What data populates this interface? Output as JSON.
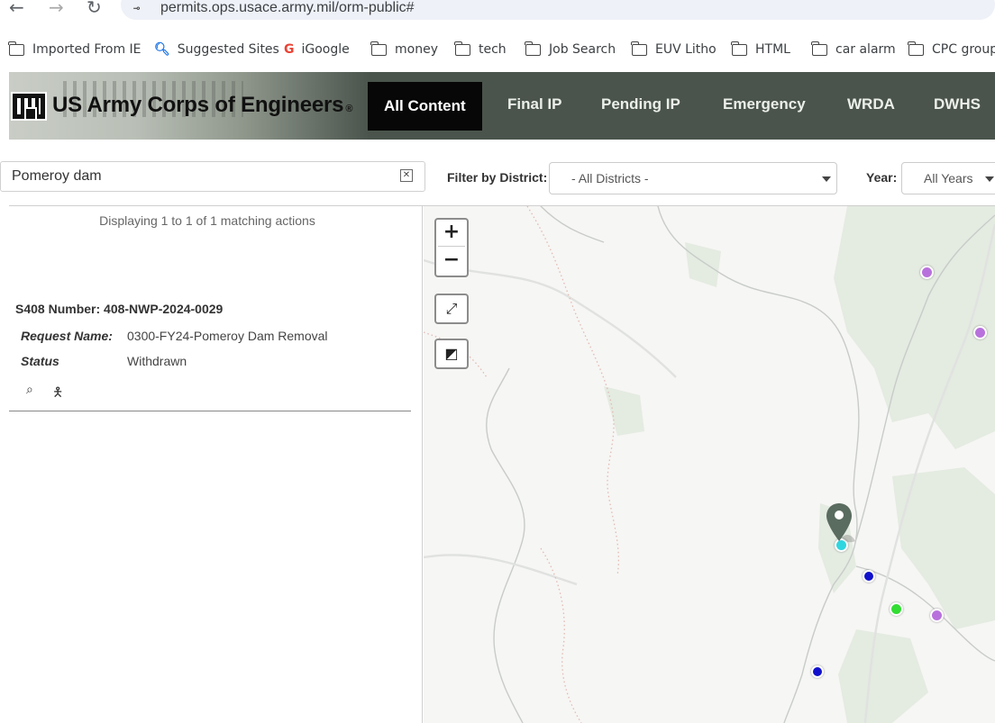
{
  "browser": {
    "back_icon": "back-arrow-icon",
    "forward_icon": "forward-arrow-icon",
    "reload_icon": "reload-icon",
    "url": "permits.ops.usace.army.mil/orm-public#",
    "bookmarks": [
      {
        "label": "Imported From IE",
        "icon": "folder-icon"
      },
      {
        "label": "Suggested Sites",
        "icon": "search-icon"
      },
      {
        "label": "iGoogle",
        "icon": "google-icon"
      },
      {
        "label": "money",
        "icon": "folder-icon"
      },
      {
        "label": "tech",
        "icon": "folder-icon"
      },
      {
        "label": "Job Search",
        "icon": "folder-icon"
      },
      {
        "label": "EUV Litho",
        "icon": "folder-icon"
      },
      {
        "label": "HTML",
        "icon": "folder-icon"
      },
      {
        "label": "car alarm",
        "icon": "folder-icon"
      },
      {
        "label": "CPC group",
        "icon": "folder-icon"
      }
    ]
  },
  "header": {
    "logo_icon": "usace-castle-icon",
    "title": "US Army Corps of Engineers",
    "title_mark": "®",
    "nav": [
      {
        "label": "All Content",
        "active": true
      },
      {
        "label": "Final IP",
        "active": false
      },
      {
        "label": "Pending IP",
        "active": false
      },
      {
        "label": "Emergency",
        "active": false
      },
      {
        "label": "WRDA",
        "active": false
      },
      {
        "label": "DWHS",
        "active": false
      }
    ]
  },
  "filters": {
    "search_value": "Pomeroy dam",
    "clear_icon": "clear-icon",
    "district_label": "Filter by District:",
    "district_value": "- All Districts -",
    "year_label": "Year:",
    "year_value": "All Years"
  },
  "results": {
    "count_text": "Displaying 1 to 1 of 1 matching actions",
    "items": [
      {
        "number_text": "S408 Number: 408-NWP-2024-0029",
        "request_label": "Request Name:",
        "request_value": "0300-FY24-Pomeroy Dam Removal",
        "status_label": "Status",
        "status_value": "Withdrawn",
        "icons": [
          "details-search-icon",
          "person-icon"
        ]
      }
    ]
  },
  "map": {
    "zoom_in": "+",
    "zoom_out": "−",
    "controls": [
      "zoom-in-icon",
      "zoom-out-icon",
      "draw-icon",
      "fullscreen-icon"
    ],
    "marker_colors": {
      "selected": "#2fd6df",
      "blue": "#1111cc",
      "green": "#33dd33",
      "purple": "#b871dc",
      "pin": "#5a6b5f"
    }
  },
  "colors": {
    "header_bg": "#4a544c",
    "active_nav_bg": "#070707"
  }
}
